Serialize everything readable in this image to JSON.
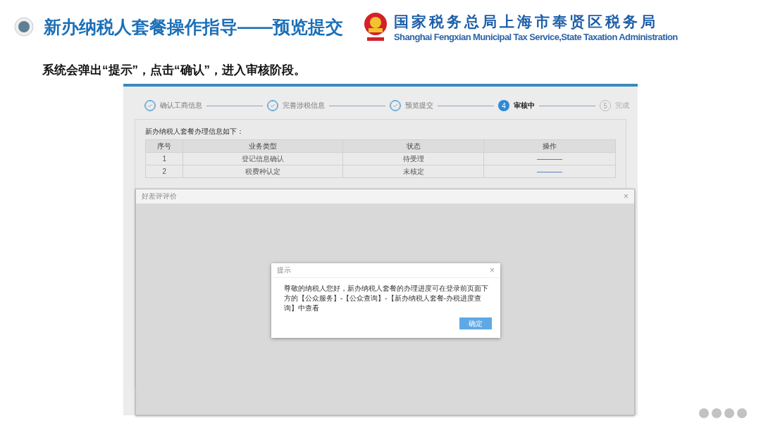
{
  "slide": {
    "title": "新办纳税人套餐操作指导——预览提交",
    "org_name_cn": "国家税务总局上海市奉贤区税务局",
    "org_name_en": "Shanghai Fengxian Municipal Tax Service,State Taxation Administration",
    "subtitle": "系统会弹出“提示”，点击“确认”，进入审核阶段。"
  },
  "steps": [
    {
      "label": "确认工商信息",
      "completed": true,
      "current": false
    },
    {
      "label": "完善涉税信息",
      "completed": true,
      "current": false
    },
    {
      "label": "预览提交",
      "completed": true,
      "current": false
    },
    {
      "number": "4",
      "label": "审核中",
      "completed": false,
      "current": true
    },
    {
      "number": "5",
      "label": "完成",
      "completed": false,
      "current": false
    }
  ],
  "table": {
    "heading": "新办纳税人套餐办理信息如下：",
    "columns": [
      "序号",
      "业务类型",
      "状态",
      "操作"
    ],
    "rows": [
      {
        "index": "1",
        "type": "登记信息确认",
        "status": "待受理"
      },
      {
        "index": "2",
        "type": "税费种认定",
        "status": "未核定"
      }
    ]
  },
  "review_modal": {
    "title": "好差评评价",
    "close": "×"
  },
  "dialog": {
    "title": "提示",
    "close": "×",
    "message": "尊敬的纳税人您好，新办纳税人套餐的办理进度可在登录前页面下方的【公众服务】-【公众查询】-【新办纳税人套餐-办税进度查询】中查看",
    "button": "确定"
  }
}
